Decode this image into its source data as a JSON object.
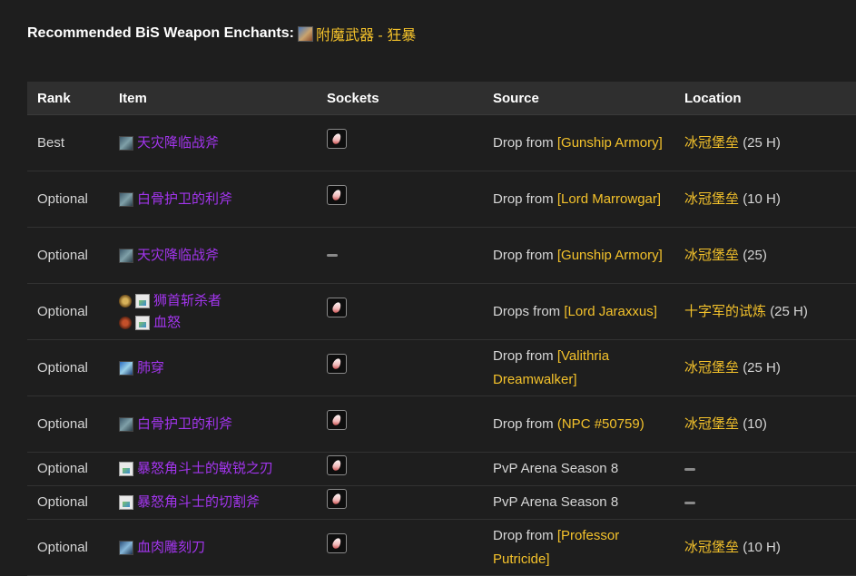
{
  "header": {
    "label": "Recommended BiS Weapon Enchants:",
    "enchant_name": "附魔武器 - 狂暴",
    "enchant_icon": "enchant-scroll-icon"
  },
  "table": {
    "columns": [
      "Rank",
      "Item",
      "Sockets",
      "Source",
      "Location"
    ],
    "rows": [
      {
        "rank": "Best",
        "items": [
          {
            "icon": "axe-icon",
            "name": "天灾降临战斧"
          }
        ],
        "socket": "red-gem",
        "source_prefix": "Drop from",
        "source_link": "[Gunship Armory]",
        "location_link": "冰冠堡垒",
        "location_suffix": "(25 H)"
      },
      {
        "rank": "Optional",
        "items": [
          {
            "icon": "axe-icon",
            "name": "白骨护卫的利斧"
          }
        ],
        "socket": "red-gem",
        "source_prefix": "Drop from",
        "source_link": "[Lord Marrowgar]",
        "location_link": "冰冠堡垒",
        "location_suffix": "(10 H)"
      },
      {
        "rank": "Optional",
        "items": [
          {
            "icon": "axe-icon",
            "name": "天灾降临战斧"
          }
        ],
        "socket": "none",
        "source_prefix": "Drop from",
        "source_link": "[Gunship Armory]",
        "location_link": "冰冠堡垒",
        "location_suffix": "(25)"
      },
      {
        "rank": "Optional",
        "items": [
          {
            "icon": "trinket-icon",
            "name": "狮首斩杀者"
          },
          {
            "icon": "eye-icon",
            "name": "血怒"
          }
        ],
        "socket": "red-gem",
        "source_prefix": "Drops from",
        "source_link": "[Lord Jaraxxus]",
        "location_link": "十字军的试炼",
        "location_suffix": "(25 H)"
      },
      {
        "rank": "Optional",
        "items": [
          {
            "icon": "spear-icon",
            "name": "肺穿"
          }
        ],
        "socket": "red-gem",
        "source_prefix": "Drop from",
        "source_link": "[Valithria Dreamwalker]",
        "location_link": "冰冠堡垒",
        "location_suffix": "(25 H)"
      },
      {
        "rank": "Optional",
        "items": [
          {
            "icon": "axe-icon",
            "name": "白骨护卫的利斧"
          }
        ],
        "socket": "red-gem",
        "source_prefix": "Drop from",
        "source_link": "(NPC #50759)",
        "location_link": "冰冠堡垒",
        "location_suffix": "(10)"
      },
      {
        "rank": "Optional",
        "items": [
          {
            "icon": "broken-image-icon",
            "name": "暴怒角斗士的敏锐之刃"
          }
        ],
        "socket": "red-gem",
        "source_prefix": "PvP Arena Season 8",
        "source_link": "",
        "location_link": "",
        "location_suffix": ""
      },
      {
        "rank": "Optional",
        "items": [
          {
            "icon": "broken-image-icon",
            "name": "暴怒角斗士的切割斧"
          }
        ],
        "socket": "red-gem",
        "source_prefix": "PvP Arena Season 8",
        "source_link": "",
        "location_link": "",
        "location_suffix": ""
      },
      {
        "rank": "Optional",
        "items": [
          {
            "icon": "cleaver-icon",
            "name": "血肉雕刻刀"
          }
        ],
        "socket": "red-gem",
        "source_prefix": "Drop from",
        "source_link": "[Professor Putricide]",
        "location_link": "冰冠堡垒",
        "location_suffix": "(10 H)"
      }
    ]
  },
  "colors": {
    "background": "#1e1e1e",
    "header_bg": "#2f2f2f",
    "epic_purple": "#a335ee",
    "link_gold": "#f4c22b",
    "text": "#d6d6d6"
  }
}
